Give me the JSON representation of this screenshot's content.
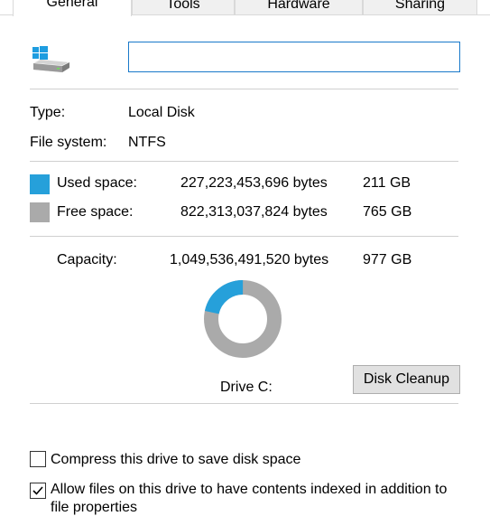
{
  "tabs": [
    {
      "label": "General",
      "active": true
    },
    {
      "label": "Tools",
      "active": false
    },
    {
      "label": "Hardware",
      "active": false
    },
    {
      "label": "Sharing",
      "active": false
    }
  ],
  "drive_icon": "windows-drive-icon",
  "name_field": {
    "value": ""
  },
  "type": {
    "label": "Type:",
    "value": "Local Disk"
  },
  "file_system": {
    "label": "File system:",
    "value": "NTFS"
  },
  "used": {
    "label": "Used space:",
    "bytes": "227,223,453,696 bytes",
    "size": "211 GB",
    "color": "#26a0da"
  },
  "free": {
    "label": "Free space:",
    "bytes": "822,313,037,824 bytes",
    "size": "765 GB",
    "color": "#aaaaaa"
  },
  "capacity": {
    "label": "Capacity:",
    "bytes": "1,049,536,491,520 bytes",
    "size": "977 GB"
  },
  "usage_chart": {
    "used_fraction": 0.2165
  },
  "drive_label": "Drive C:",
  "cleanup_button": "Disk Cleanup",
  "options": {
    "compress": {
      "label": "Compress this drive to save disk space",
      "checked": false
    },
    "index": {
      "label_line1": "Allow files on this drive to have contents indexed in addition to",
      "label_line2": "file properties",
      "checked": true
    }
  }
}
